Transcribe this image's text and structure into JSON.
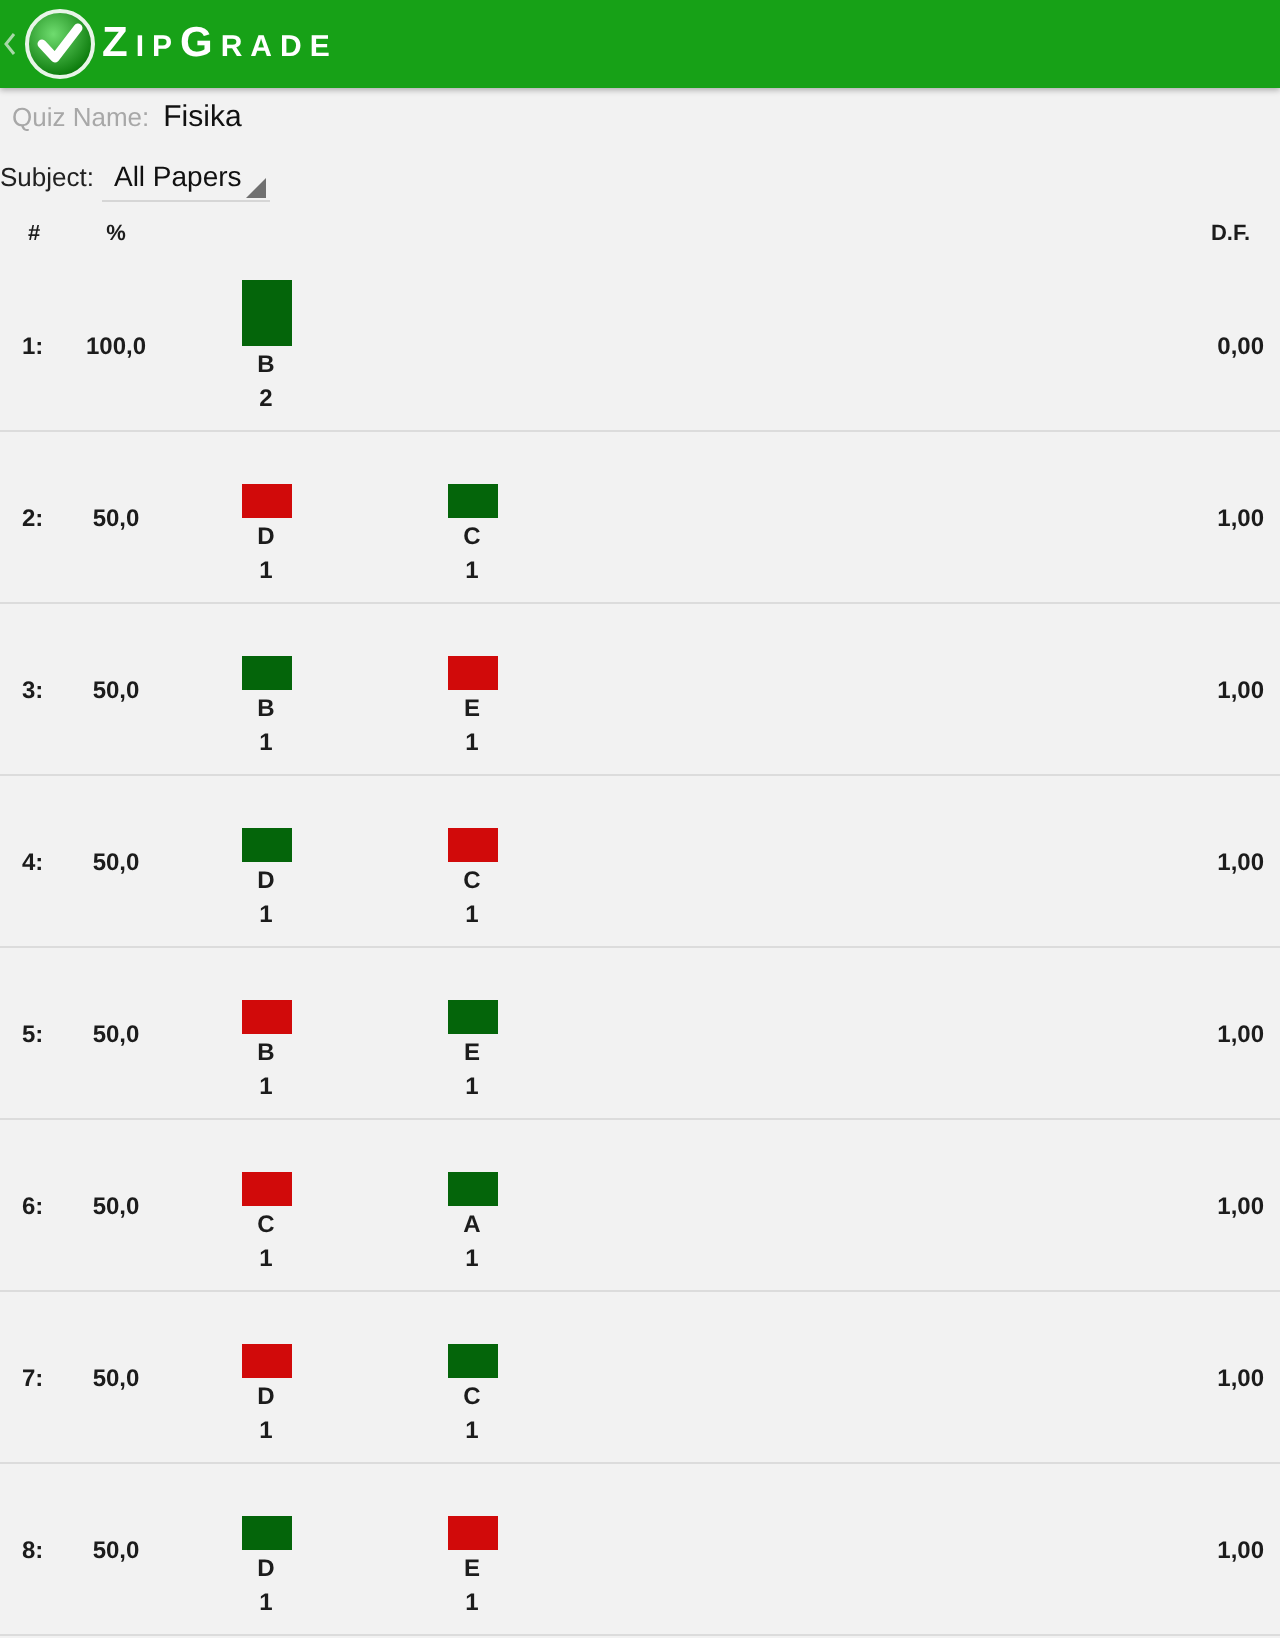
{
  "app_bar": {
    "title": "ZipGrade"
  },
  "quiz": {
    "label": "Quiz Name:",
    "value": "Fisika"
  },
  "subject": {
    "label": "Subject:",
    "value": "All Papers"
  },
  "table": {
    "columns": [
      "#",
      "%",
      "D.F."
    ],
    "rows": [
      {
        "number": "1:",
        "percent": "100,0",
        "answers": [
          {
            "letter": "B",
            "count": "2",
            "correct": true,
            "level": 1
          }
        ],
        "df": "0,00"
      },
      {
        "number": "2:",
        "percent": "50,0",
        "answers": [
          {
            "letter": "D",
            "count": "1",
            "correct": false,
            "level": 0.5
          },
          {
            "letter": "C",
            "count": "1",
            "correct": true,
            "level": 0.5
          }
        ],
        "df": "1,00"
      },
      {
        "number": "3:",
        "percent": "50,0",
        "answers": [
          {
            "letter": "B",
            "count": "1",
            "correct": true,
            "level": 0.5
          },
          {
            "letter": "E",
            "count": "1",
            "correct": false,
            "level": 0.5
          }
        ],
        "df": "1,00"
      },
      {
        "number": "4:",
        "percent": "50,0",
        "answers": [
          {
            "letter": "D",
            "count": "1",
            "correct": true,
            "level": 0.5
          },
          {
            "letter": "C",
            "count": "1",
            "correct": false,
            "level": 0.5
          }
        ],
        "df": "1,00"
      },
      {
        "number": "5:",
        "percent": "50,0",
        "answers": [
          {
            "letter": "B",
            "count": "1",
            "correct": false,
            "level": 0.5
          },
          {
            "letter": "E",
            "count": "1",
            "correct": true,
            "level": 0.5
          }
        ],
        "df": "1,00"
      },
      {
        "number": "6:",
        "percent": "50,0",
        "answers": [
          {
            "letter": "C",
            "count": "1",
            "correct": false,
            "level": 0.5
          },
          {
            "letter": "A",
            "count": "1",
            "correct": true,
            "level": 0.5
          }
        ],
        "df": "1,00"
      },
      {
        "number": "7:",
        "percent": "50,0",
        "answers": [
          {
            "letter": "D",
            "count": "1",
            "correct": false,
            "level": 0.5
          },
          {
            "letter": "C",
            "count": "1",
            "correct": true,
            "level": 0.5
          }
        ],
        "df": "1,00"
      },
      {
        "number": "8:",
        "percent": "50,0",
        "answers": [
          {
            "letter": "D",
            "count": "1",
            "correct": true,
            "level": 0.5
          },
          {
            "letter": "E",
            "count": "1",
            "correct": false,
            "level": 0.5
          }
        ],
        "df": "1,00"
      }
    ]
  }
}
